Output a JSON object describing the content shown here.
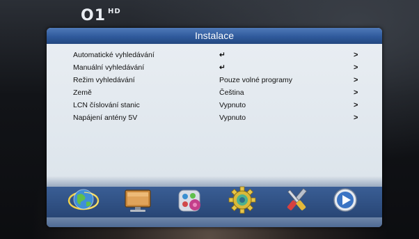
{
  "channel": {
    "logo": "O1",
    "badge": "HD"
  },
  "title": "Instalace",
  "rows": [
    {
      "label": "Automatické vyhledávání",
      "value": "↵",
      "arrow": ">"
    },
    {
      "label": "Manuální vyhledávání",
      "value": "↵",
      "arrow": ">"
    },
    {
      "label": "Režim vyhledávání",
      "value": "Pouze volné programy",
      "arrow": ">"
    },
    {
      "label": "Země",
      "value": "Čeština",
      "arrow": ">"
    },
    {
      "label": "LCN číslování stanic",
      "value": "Vypnuto",
      "arrow": ">"
    },
    {
      "label": "Napájení antény 5V",
      "value": "Vypnuto",
      "arrow": ">"
    }
  ],
  "icons": [
    "globe-satellite-icon",
    "tv-monitor-icon",
    "palette-icon",
    "gear-icon",
    "tools-icon",
    "play-icon"
  ],
  "colors": {
    "title_bar": "#2f5a9c",
    "panel_bg": "#e4eaf0",
    "icon_bar": "#2c4b7c"
  }
}
